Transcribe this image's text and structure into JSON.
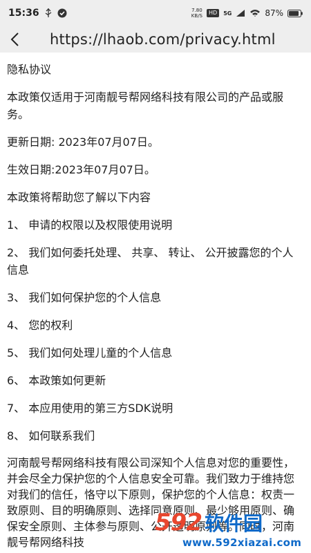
{
  "status_bar": {
    "time": "15:36",
    "net_speed_value": "7.80",
    "net_speed_unit": "KB/S",
    "hd_badge": "HD",
    "signal_5g": "5G",
    "battery": "87%"
  },
  "url_bar": {
    "url": "https://lhaob.com/privacy.html"
  },
  "content": {
    "title": "隐私协议",
    "intro": "本政策仅适用于河南靓号帮网络科技有限公司的产品或服务。",
    "updated": "更新日期: 2023年07月07日。",
    "effective": "生效日期:2023年07月07日。",
    "toc_intro": "本政策将帮助您了解以下内容",
    "toc": [
      "1、 申请的权限以及权限使用说明",
      "2、 我们如何委托处理、 共享、 转让、 公开披露您的个人信息",
      "3、 我们如何保护您的个人信息",
      "4、 您的权利",
      "5、 我们如何处理儿童的个人信息",
      "6、 本政策如何更新",
      "7、 本应用使用的第三方SDK说明",
      "8、 如何联系我们"
    ],
    "body": "河南靓号帮网络科技有限公司深知个人信息对您的重要性，并会尽全力保护您的个人信息安全可靠。我们致力于维持您对我们的信任，恪守以下原则，保护您的个人信息：权责一致原则、目的明确原则、选择同意原则、最少够用原则、确保安全原则、主体参与原则、公开透明原则等。同时，河南靓号帮网络科技"
  },
  "watermark": {
    "number": "592",
    "brand": "软件园",
    "site": "www.592xiazai.com"
  }
}
